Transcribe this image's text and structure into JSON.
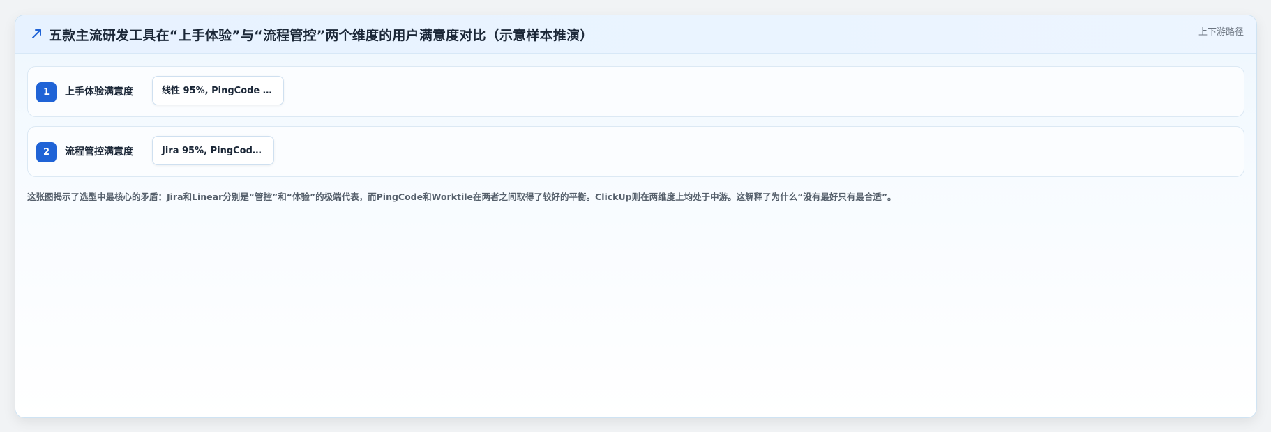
{
  "header": {
    "icon": "trend-up-arrow-icon",
    "title": "五款主流研发工具在“上手体验”与“流程管控”两个维度的用户满意度对比（示意样本推演）",
    "corner_link": "上下游路径"
  },
  "rows": [
    {
      "index": "1",
      "label": "上手体验满意度",
      "value": "线性 95%, PingCode 9..."
    },
    {
      "index": "2",
      "label": "流程管控满意度",
      "value": "Jira 95%, PingCode..."
    }
  ],
  "footnote": "这张图揭示了选型中最核心的矛盾：Jira和Linear分别是“管控”和“体验”的极端代表，而PingCode和Worktile在两者之间取得了较好的平衡。ClickUp则在两维度上均处于中游。这解释了为什么“没有最好只有最合适”。",
  "colors": {
    "accent": "#1f63d6",
    "title_text": "#1b2737",
    "muted_text": "#6b7480"
  }
}
